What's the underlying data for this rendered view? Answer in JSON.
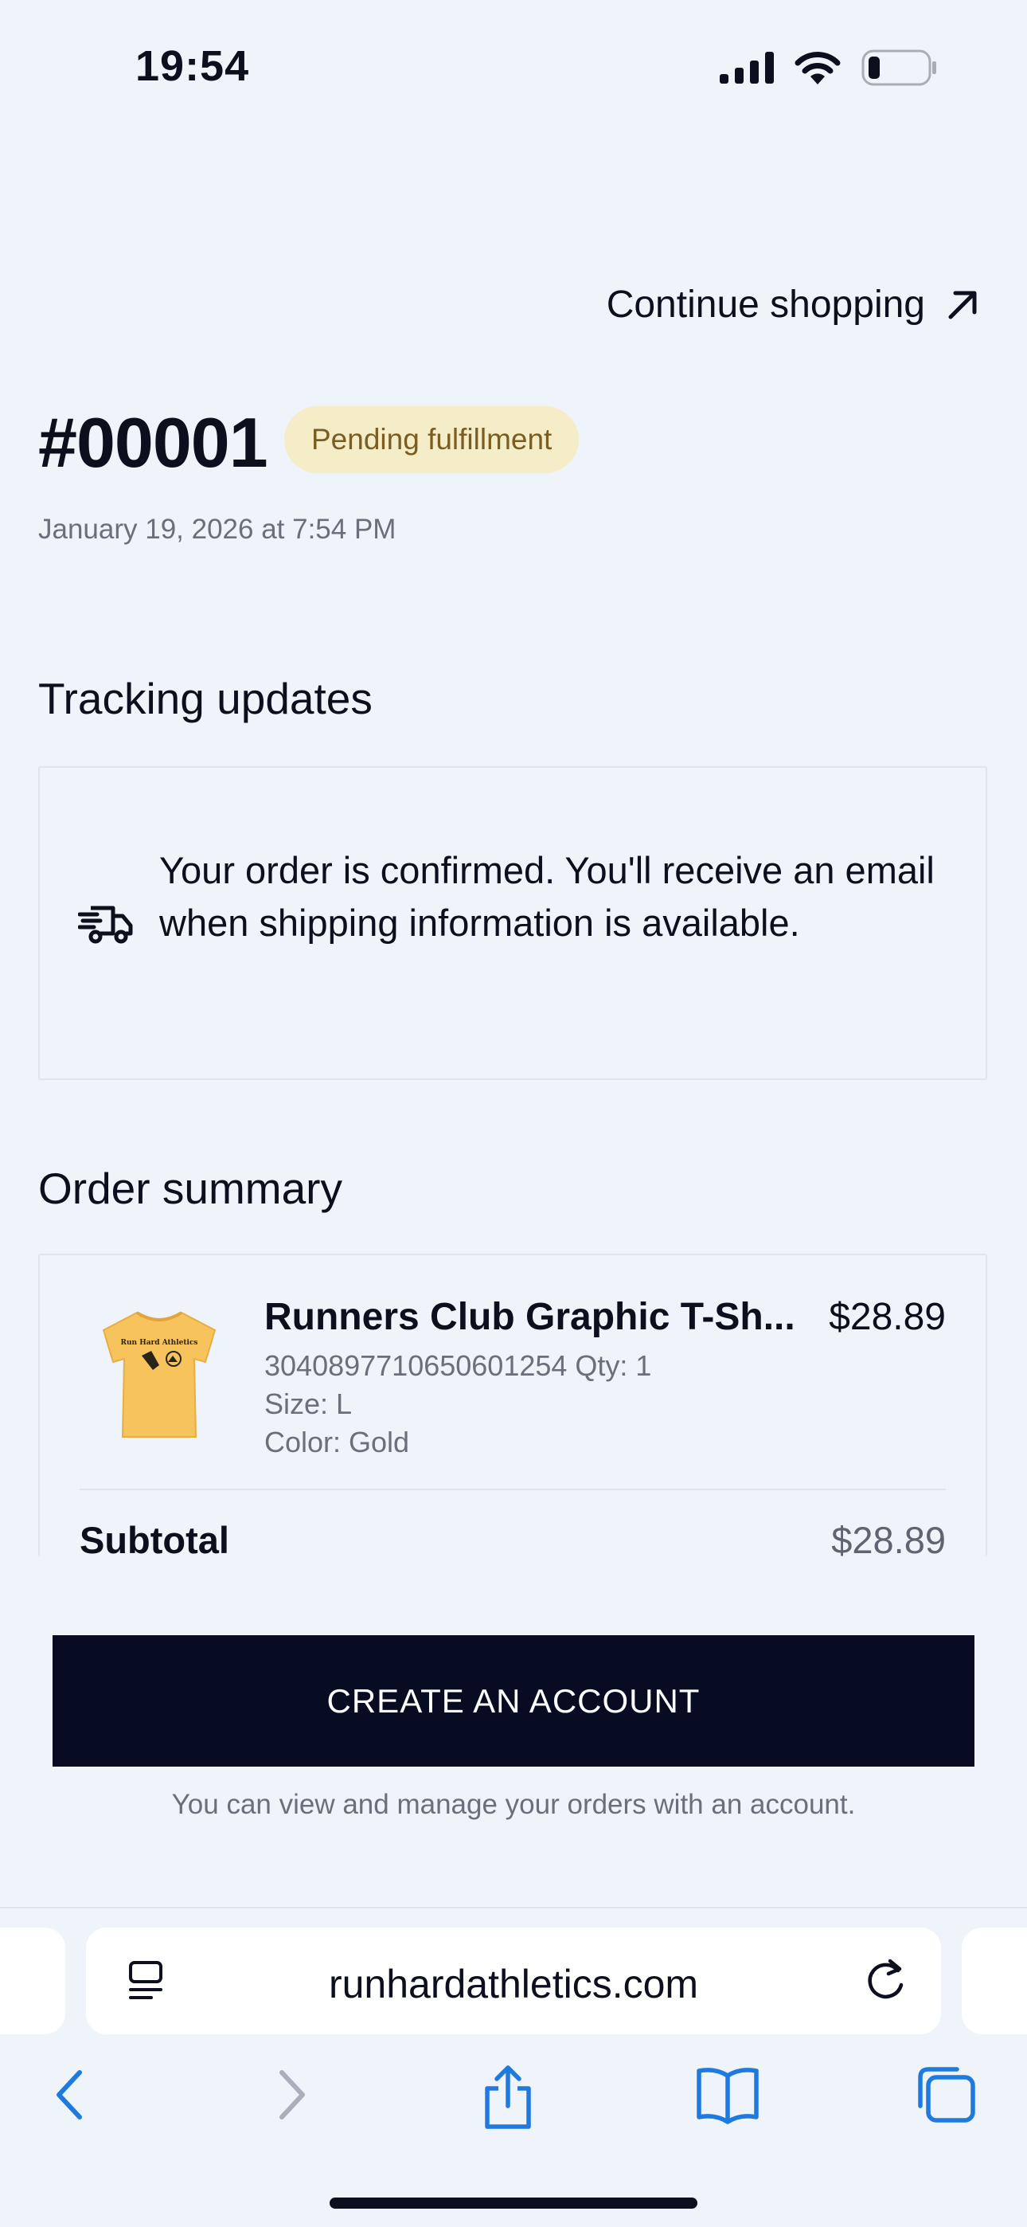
{
  "status_bar": {
    "time": "19:54"
  },
  "header": {
    "continue_label": "Continue shopping",
    "order_number": "#00001",
    "status_badge": "Pending fulfillment",
    "order_date": "January 19, 2026 at 7:54 PM"
  },
  "tracking": {
    "title": "Tracking updates",
    "message": "Your order is confirmed. You'll receive an email when shipping information is available.",
    "icon": "truck-icon"
  },
  "summary": {
    "title": "Order summary",
    "item": {
      "name": "Runners Club Graphic T-Sh...",
      "price": "$28.89",
      "sku_qty": "3040897710650601254 Qty: 1",
      "size": "Size: L",
      "color": "Color: Gold",
      "shirt_print": "Run Hard Athletics"
    },
    "subtotal_label": "Subtotal",
    "subtotal_value": "$28.89"
  },
  "cta": {
    "label": "CREATE AN ACCOUNT",
    "note": "You can view and manage your orders with an account."
  },
  "browser": {
    "url": "runhardathletics.com"
  },
  "colors": {
    "background": "#eff3fa",
    "badge_bg": "#f5edc8",
    "badge_text": "#7b5d22",
    "cta_bg": "#070c22",
    "safari_blue": "#1f7ae0",
    "shirt": "#f7c35c"
  }
}
